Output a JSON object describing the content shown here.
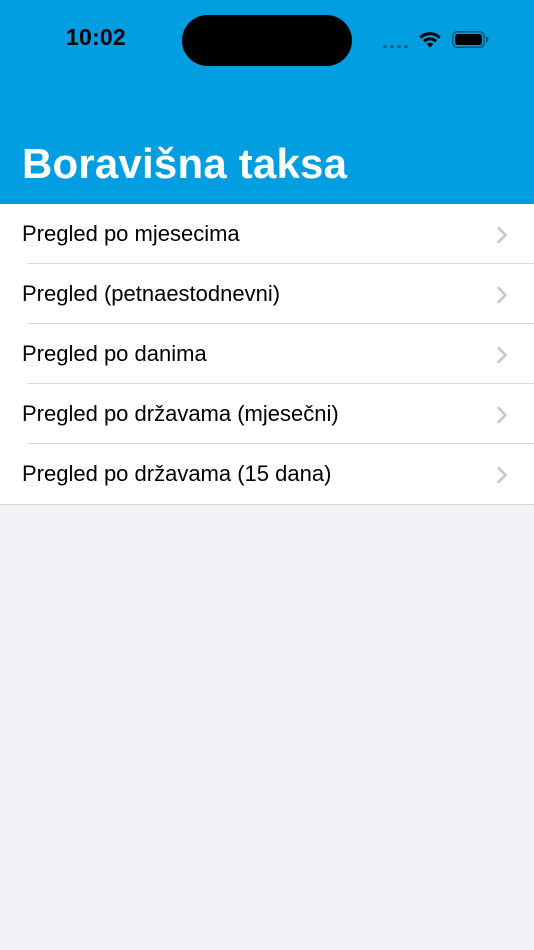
{
  "status_bar": {
    "time": "10:02",
    "icons": [
      "cellular-signal-icon",
      "wifi-icon",
      "battery-icon"
    ]
  },
  "header": {
    "title": "Boravišna taksa",
    "background_color": "#009DE1"
  },
  "menu": {
    "items": [
      {
        "label": "Pregled po mjesecima"
      },
      {
        "label": "Pregled (petnaestodnevni)"
      },
      {
        "label": "Pregled po danima"
      },
      {
        "label": "Pregled po državama (mjesečni)"
      },
      {
        "label": "Pregled po državama (15 dana)"
      }
    ],
    "chevron_icon": "chevron-right-icon"
  },
  "colors": {
    "page_background": "#F1F1F6",
    "list_background": "#FFFFFF",
    "chevron": "#C4C4C7"
  }
}
